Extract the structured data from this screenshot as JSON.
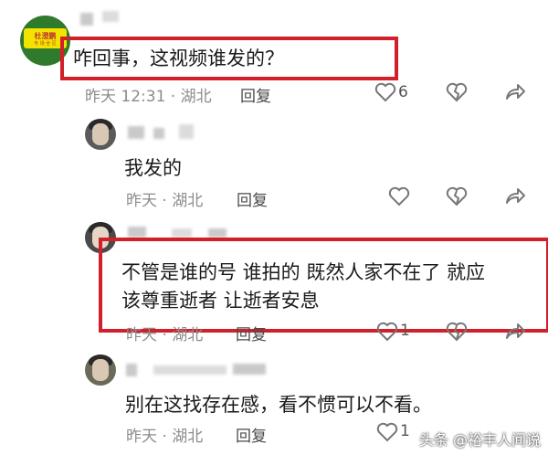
{
  "comments": [
    {
      "text": "咋回事，这视频谁发的？",
      "meta": "昨天 12:31 · 湖北",
      "reply_label": "回复",
      "like_count": "6",
      "avatar_sign": "杜澄鹏",
      "avatar_sign_sub": "专 场 全 区"
    },
    {
      "text": "我发的",
      "meta": "昨天 · 湖北",
      "reply_label": "回复"
    },
    {
      "text_line1": "不管是谁的号 谁拍的 既然人家不在了 就应",
      "text_line2": "该尊重逝者 让逝者安息",
      "meta": "昨天 · 湖北",
      "reply_label": "回复",
      "like_count": "1"
    },
    {
      "text": "别在这找存在感，看不惯可以不看。",
      "meta": "昨天 · 湖北",
      "reply_label": "回复",
      "like_count": "1"
    }
  ],
  "watermark": "头条 @裕丰人间说",
  "colors": {
    "highlight": "#d1202a",
    "meta": "#8c8c8c"
  }
}
